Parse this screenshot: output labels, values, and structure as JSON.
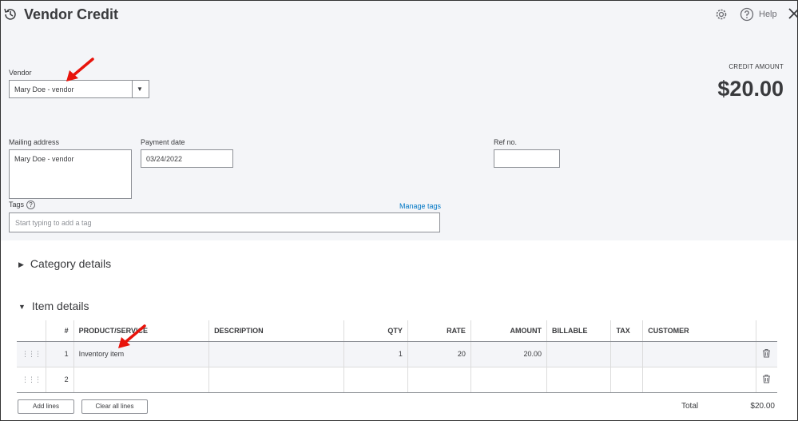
{
  "header": {
    "title": "Vendor Credit",
    "help_label": "Help"
  },
  "vendor": {
    "label": "Vendor",
    "value": "Mary Doe - vendor"
  },
  "credit": {
    "label": "CREDIT AMOUNT",
    "amount": "$20.00"
  },
  "mailing": {
    "label": "Mailing address",
    "value": "Mary Doe - vendor"
  },
  "payment_date": {
    "label": "Payment date",
    "value": "03/24/2022"
  },
  "ref": {
    "label": "Ref no.",
    "value": ""
  },
  "tags": {
    "label": "Tags",
    "help": "?",
    "manage": "Manage tags",
    "placeholder": "Start typing to add a tag"
  },
  "sections": {
    "category": "Category details",
    "item": "Item details"
  },
  "table": {
    "headers": [
      "",
      "#",
      "PRODUCT/SERVICE",
      "DESCRIPTION",
      "QTY",
      "RATE",
      "AMOUNT",
      "BILLABLE",
      "TAX",
      "CUSTOMER",
      ""
    ],
    "rows": [
      {
        "num": "1",
        "product": "Inventory item",
        "description": "",
        "qty": "1",
        "rate": "20",
        "amount": "20.00",
        "billable": "",
        "tax": "",
        "customer": ""
      },
      {
        "num": "2",
        "product": "",
        "description": "",
        "qty": "",
        "rate": "",
        "amount": "",
        "billable": "",
        "tax": "",
        "customer": ""
      }
    ]
  },
  "buttons": {
    "add_lines": "Add lines",
    "clear_lines": "Clear all lines"
  },
  "total": {
    "label": "Total",
    "value": "$20.00"
  },
  "icons": {
    "history": "history-icon",
    "gear": "gear-icon",
    "help": "help-icon",
    "close": "close-icon",
    "drag": "drag-handle-icon",
    "trash": "trash-icon",
    "arrow": "annotation-arrow"
  },
  "colors": {
    "header_bg": "#f4f5f8",
    "link": "#0077c5",
    "annotation": "#e8140c"
  }
}
